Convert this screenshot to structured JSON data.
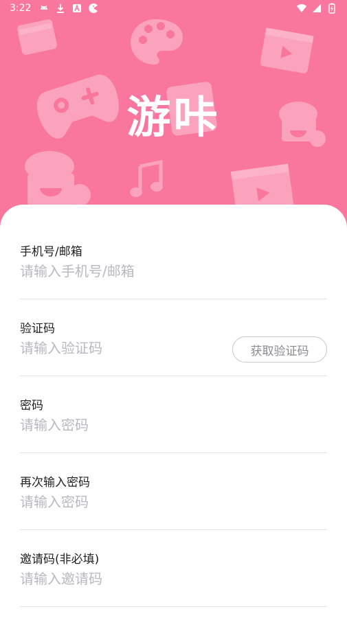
{
  "status_bar": {
    "time": "3:22",
    "left_icons": [
      "android-icon",
      "download-icon",
      "a-box-icon",
      "pac-icon"
    ],
    "right_icons": [
      "wifi-icon",
      "signal-icon",
      "battery-icon"
    ]
  },
  "header": {
    "title": "游咔",
    "background_color": "#f9779d"
  },
  "form": {
    "fields": [
      {
        "label": "手机号/邮箱",
        "placeholder": "请输入手机号/邮箱",
        "value": ""
      },
      {
        "label": "验证码",
        "placeholder": "请输入验证码",
        "value": "",
        "action": "获取验证码"
      },
      {
        "label": "密码",
        "placeholder": "请输入密码",
        "value": ""
      },
      {
        "label": "再次输入密码",
        "placeholder": "请输入密码",
        "value": ""
      },
      {
        "label": "邀请码(非必填)",
        "placeholder": "请输入邀请码",
        "value": ""
      }
    ]
  }
}
